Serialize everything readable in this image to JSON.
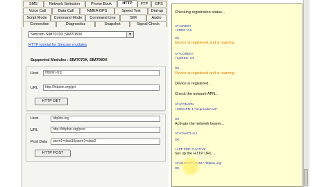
{
  "tabs": {
    "row1": [
      "SMS",
      "Network Selection",
      "Phone Book",
      "HTTP",
      "FTP",
      "GPS"
    ],
    "row2": [
      "Voice Call",
      "Data Call",
      "NMEA GPS",
      "Speed Test",
      "Dial-up"
    ],
    "row3": [
      "Script Mode",
      "Command Mode",
      "Command Line",
      "SIM",
      "Audio"
    ],
    "row4": [
      "Connection",
      "Diagnostics",
      "Snapshot",
      "Signal Check"
    ],
    "active": "HTTP"
  },
  "module": {
    "selected": "Simcom-SIM7070X,SIM7080X",
    "tutorial_link": "HTTP tutorial for Simcom modules",
    "supported_label": "Supported Modules : SIM7070X, SIM7080X"
  },
  "get": {
    "host_label": "Host",
    "host_value": "httpbin.org",
    "url_label": "URL",
    "url_value": "http://httpbin.org/get",
    "button": "HTTP GET"
  },
  "post": {
    "host_label": "Host",
    "host_value": "httpbin.org",
    "url_label": "URL",
    "url_value": "http://httpbin.org/post",
    "data_label": "Post Data",
    "data_value": "parm1=data1&parm2=data2",
    "button": "HTTP POST"
  },
  "log": [
    {
      "text": "Checking registration status...",
      "style": "plain"
    },
    {
      "text": "AT+CREG?",
      "style": "cmd"
    },
    {
      "text": "+CREG: 0,5",
      "style": "cmd"
    },
    {
      "text": "OK",
      "style": "ok"
    },
    {
      "text": "Device is registered and is roaming",
      "style": "warn"
    },
    {
      "text": "AT+CGREG?",
      "style": "cmd"
    },
    {
      "text": "+CGREG: 0,5",
      "style": "cmd"
    },
    {
      "text": "OK",
      "style": "ok"
    },
    {
      "text": "Device is registered and is roaming",
      "style": "warn"
    },
    {
      "text": "Device is registered.",
      "style": "plain"
    },
    {
      "text": "Check the network APN...",
      "style": "plain"
    },
    {
      "text": "AT+CGNAPN",
      "style": "cmd"
    },
    {
      "text": "+CGNAPN: 1,\"iot.provider.net\"",
      "style": "cmd"
    },
    {
      "text": "OK",
      "style": "ok"
    },
    {
      "text": "Activate the network bearer...",
      "style": "plain"
    },
    {
      "text": "AT+CNACT=0,1",
      "style": "cmd"
    },
    {
      "text": "OK",
      "style": "ok"
    },
    {
      "text": "+APP PDP: 0,ACTIVE",
      "style": "cmd"
    },
    {
      "text": "Set up the HTTP URL...",
      "style": "plain"
    },
    {
      "text": "AT+SHCONF=\"URL\",\"httpbin.org\"",
      "style": "cmd"
    },
    {
      "text": "OK",
      "style": "ok"
    }
  ]
}
